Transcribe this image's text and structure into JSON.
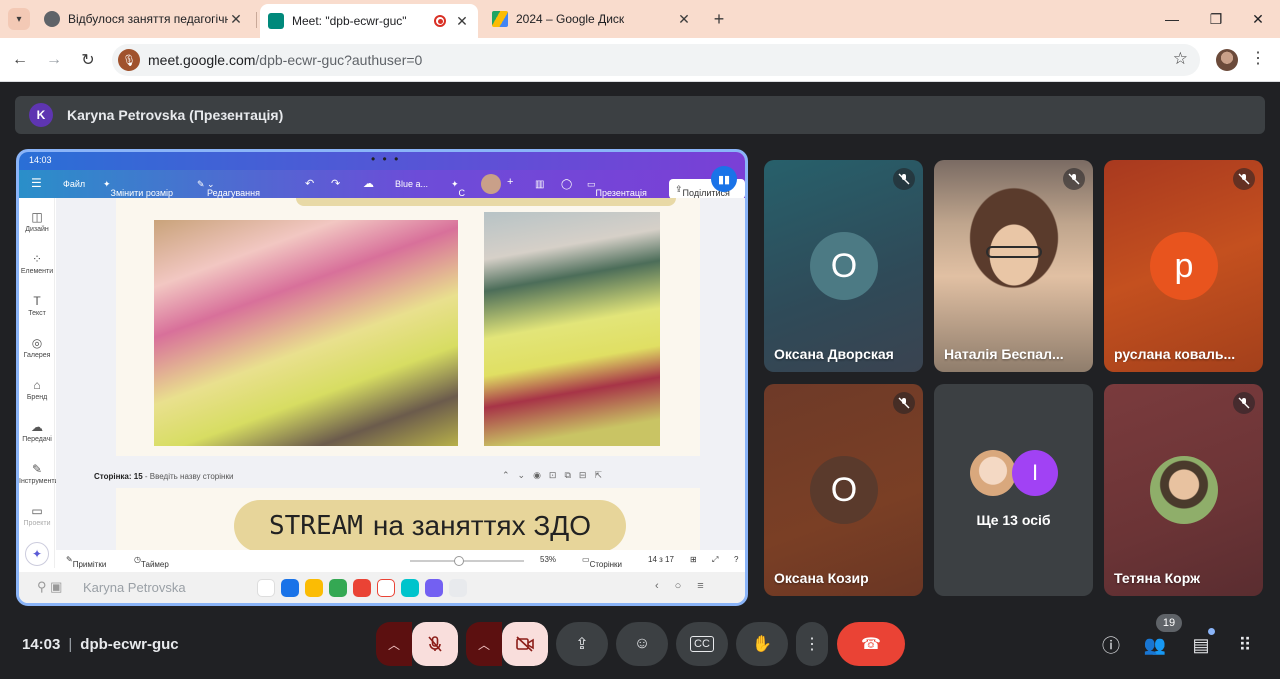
{
  "browser": {
    "tabs": [
      {
        "title": "Відбулося заняття педагогічно",
        "favicon_color": "#5f6368"
      },
      {
        "title": "Meet: \"dpb-ecwr-guc\"",
        "favicon_color": "#00897b",
        "active": true
      },
      {
        "title": "2024 – Google Диск",
        "favicon_color": "#fbbc04"
      }
    ],
    "url_host": "meet.google.com",
    "url_path": "/dpb-ecwr-guc?authuser=0"
  },
  "meet": {
    "presenter_initial": "K",
    "presenter_label": "Karyna Petrovska (Презентація)",
    "time": "14:03",
    "meeting_code": "dpb-ecwr-guc",
    "participant_count": "19",
    "accent_colors": {
      "end_call": "#ea4335",
      "muted_control": "#f9dedc",
      "presenting_border": "#8ab4f8"
    }
  },
  "presentation": {
    "status_time": "14:03",
    "toolbar": {
      "file": "Файл",
      "resize": "Змінити розмір",
      "editing": "Редагування",
      "doc_name": "Blue a...",
      "c": "C",
      "present": "Презентація",
      "share": "Поділитися"
    },
    "sidebar": [
      {
        "label": "Дизайн",
        "icon": "design-icon"
      },
      {
        "label": "Елементи",
        "icon": "elements-icon"
      },
      {
        "label": "Текст",
        "icon": "text-icon"
      },
      {
        "label": "Галерея",
        "icon": "gallery-icon"
      },
      {
        "label": "Бренд",
        "icon": "brand-icon"
      },
      {
        "label": "Передачі",
        "icon": "uploads-icon"
      },
      {
        "label": "Інструменти",
        "icon": "tools-icon"
      },
      {
        "label": "Проекти",
        "icon": "projects-icon"
      }
    ],
    "page_label_prefix": "Сторінка: 15",
    "page_label_placeholder": " - Введіть назву сторінки",
    "slide_title_latin": "STREAM",
    "slide_title_rest": "на заняттях ЗДО",
    "bottom": {
      "notes": "Примітки",
      "timer": "Таймер",
      "zoom": "53%",
      "pages": "Сторінки",
      "page_count": "14 з 17"
    },
    "presenter_overlay": "Karyna Petrovska"
  },
  "participants": [
    {
      "name": "Оксана Дворская",
      "initial": "О",
      "avatar_color": "#4c7a84",
      "muted": true
    },
    {
      "name": "Наталія Беспал...",
      "muted": true,
      "video": true
    },
    {
      "name": "руслана коваль...",
      "initial": "р",
      "avatar_color": "#e8541e",
      "muted": true
    },
    {
      "name": "Оксана Козир",
      "initial": "О",
      "avatar_color": "#5a3a2c",
      "muted": true
    },
    {
      "name": "Ще 13 осіб",
      "extra_initial": "І"
    },
    {
      "name": "Тетяна Корж",
      "muted": true
    }
  ]
}
